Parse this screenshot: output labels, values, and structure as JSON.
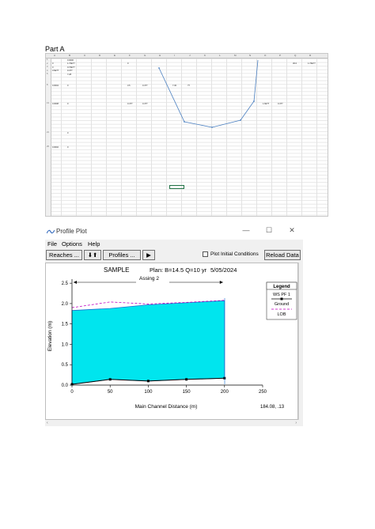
{
  "part_label": "Part A",
  "sheet": {
    "columns": [
      "A",
      "B",
      "C",
      "D",
      "E",
      "F",
      "G",
      "H",
      "I",
      "J",
      "K",
      "L",
      "M",
      "N",
      "O",
      "P",
      "Q",
      "R"
    ],
    "rows": [
      {
        "r": "1",
        "cells": [
          [
            "B",
            "0.0000",
            ""
          ]
        ]
      },
      {
        "r": "2",
        "cells": [
          [
            "A",
            "0",
            "1.76E??"
          ],
          [
            "F",
            "0",
            ""
          ],
          [
            "Q",
            "30.0",
            "1.76E??"
          ]
        ]
      },
      {
        "r": "3",
        "cells": [
          [
            "A",
            "0",
            "0.76E??"
          ]
        ]
      },
      {
        "r": "4",
        "cells": [
          [
            "A",
            "3.6E??",
            "0.4??"
          ]
        ]
      },
      {
        "r": "5",
        "cells": [
          [
            "A",
            "",
            "7.28"
          ]
        ]
      },
      {
        "r": "8",
        "cells": [
          [
            "A",
            "0.0004",
            "0"
          ],
          [
            "F",
            "3.5",
            "0.4??"
          ],
          [
            "I",
            "7.30",
            "??"
          ]
        ]
      },
      {
        "r": "13",
        "cells": [
          [
            "A",
            "0.0008",
            "0"
          ],
          [
            "F",
            "0.4??",
            "0.4??"
          ],
          [
            "O",
            "1.6E??",
            "0.4??"
          ]
        ]
      },
      {
        "r": "21",
        "cells": [
          [
            "A",
            "",
            "0"
          ]
        ]
      },
      {
        "r": "25",
        "cells": [
          [
            "A",
            "0.0002",
            "0"
          ]
        ]
      }
    ]
  },
  "window": {
    "title": "Profile Plot",
    "minimize_icon": "minimize-icon",
    "maximize_icon": "maximize-icon",
    "close_icon": "close-icon",
    "menu": [
      "File",
      "Options",
      "Help"
    ],
    "toolbar": {
      "reaches_label": "Reaches ...",
      "updown_label": "⬇⬆",
      "profiles_label": "Profiles ...",
      "play_label": "▶",
      "plot_initial_label": "Plot Initial Conditions",
      "plot_initial_checked": false,
      "reload_label": "Reload Data"
    }
  },
  "chart_data": {
    "type": "area",
    "title": "SAMPLE",
    "plan_text": "Plan: B=14.5 Q=10 yr",
    "date_text": "5/05/2024",
    "reach_label": "Assing 2",
    "xlabel": "Main Channel Distance (m)",
    "ylabel": "Elevation (m)",
    "xlim": [
      0,
      250
    ],
    "ylim": [
      0,
      2.6
    ],
    "xticks": [
      0,
      50,
      100,
      150,
      200,
      250
    ],
    "yticks": [
      0.0,
      0.5,
      1.0,
      1.5,
      2.0,
      2.5
    ],
    "ytick_labels": [
      "0.0",
      "0.5",
      "1.0",
      "1.5",
      "2.0",
      "2.5"
    ],
    "coord_readout": "184.08, .13",
    "legend": {
      "title": "Legend",
      "placement": "right",
      "entries": [
        "WS PF 1",
        "Ground",
        "LOB"
      ]
    },
    "series": [
      {
        "name": "WS PF 1",
        "color": "#00e5ee",
        "x": [
          0,
          50,
          100,
          150,
          200
        ],
        "y": [
          1.83,
          1.88,
          1.97,
          2.02,
          2.07
        ]
      },
      {
        "name": "Ground",
        "color": "#000000",
        "x": [
          0,
          50,
          100,
          150,
          200
        ],
        "y": [
          0.02,
          0.14,
          0.1,
          0.14,
          0.17
        ]
      },
      {
        "name": "LOB",
        "color": "#c000c0",
        "x": [
          0,
          50,
          100,
          150,
          200
        ],
        "y": [
          1.9,
          2.04,
          1.99,
          2.03,
          2.08
        ]
      }
    ]
  }
}
